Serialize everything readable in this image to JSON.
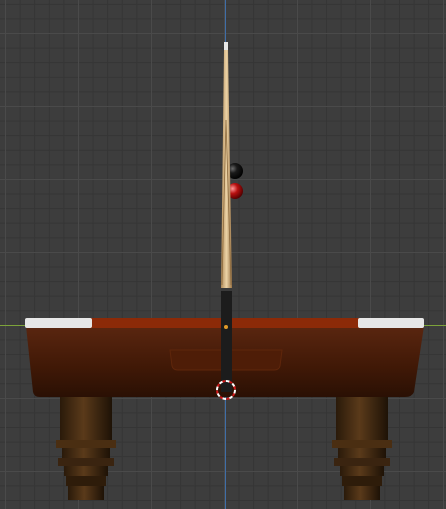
{
  "viewport": {
    "view": "front-orthographic",
    "grid": true,
    "axes": {
      "x_color": "#7da33a",
      "z_color": "#3f6ea8"
    }
  },
  "scene": {
    "objects": [
      "pool-table",
      "cue-stick",
      "ball-black",
      "ball-red"
    ],
    "colors": {
      "table_wood": "#4a1d08",
      "felt": "#8c2a08",
      "rail_caps": "#e8e8e8",
      "legs": "#3a2410",
      "cue_shaft": "#d9b98a",
      "cue_butt": "#1a1a1a"
    }
  },
  "cursor_3d": {
    "visible": true
  }
}
